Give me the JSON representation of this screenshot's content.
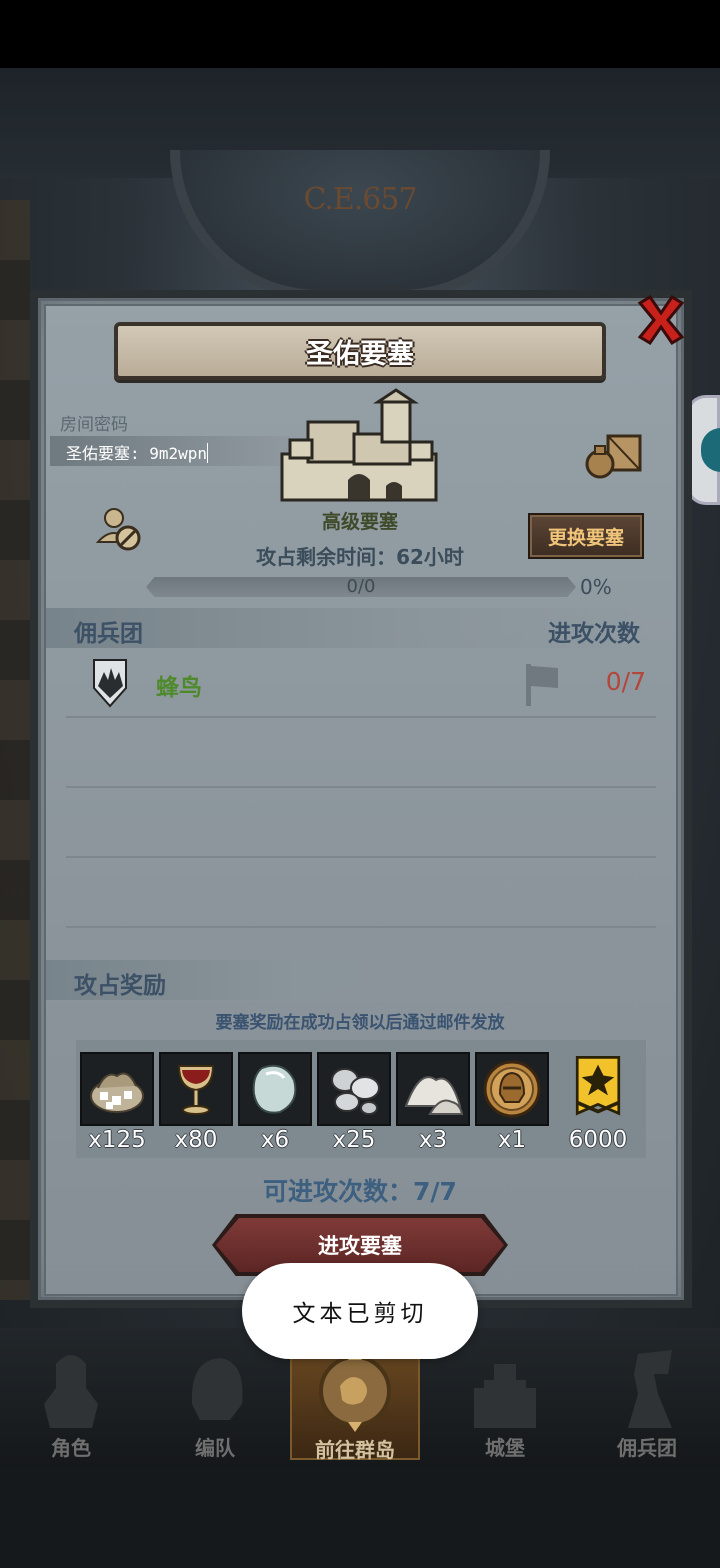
{
  "background": {
    "era": "C.E.657"
  },
  "dialog": {
    "title": "圣佑要塞",
    "room_password_label": "房间密码",
    "room_password_value": "圣佑要塞: 9m2wpn",
    "fortress_grade": "高级要塞",
    "change_button": "更换要塞",
    "time_remaining": "攻占剩余时间：62小时",
    "progress_text": "0/0",
    "progress_percent": "0%",
    "progress_fraction": 0,
    "mercenary_section": {
      "label": "佣兵团",
      "attack_count_header": "进攻次数"
    },
    "mercenaries": [
      {
        "name": "蜂鸟",
        "attacks": "0/7"
      }
    ],
    "reward_section": {
      "label": "攻占奖励",
      "note": "要塞奖励在成功占领以后通过邮件发放"
    },
    "rewards": [
      {
        "icon": "ore-sack-icon",
        "qty": "x125"
      },
      {
        "icon": "goblet-icon",
        "qty": "x80"
      },
      {
        "icon": "gemstone-icon",
        "qty": "x6"
      },
      {
        "icon": "silver-pile-icon",
        "qty": "x25"
      },
      {
        "icon": "salt-pile-icon",
        "qty": "x3"
      },
      {
        "icon": "knight-helmet-coin-icon",
        "qty": "x1"
      },
      {
        "icon": "banner-emblem-icon",
        "qty": "6000"
      }
    ],
    "remaining_attacks": "可进攻次数：7/7",
    "attack_button": "进攻要塞"
  },
  "nav": {
    "items": [
      {
        "label": "角色",
        "icon": "knight-icon"
      },
      {
        "label": "编队",
        "icon": "helmet-icon"
      },
      {
        "label": "前往群岛",
        "icon": "island-icon",
        "active": true
      },
      {
        "label": "城堡",
        "icon": "castle-icon"
      },
      {
        "label": "佣兵团",
        "icon": "mercenary-icon"
      }
    ]
  },
  "toast": {
    "text": "文本已剪切"
  },
  "colors": {
    "panel": "#8d979d",
    "accent_gold": "#f0c57a",
    "merc_green": "#4e8a2c",
    "count_red": "#b3463d",
    "button_red": "#7f3a38"
  }
}
